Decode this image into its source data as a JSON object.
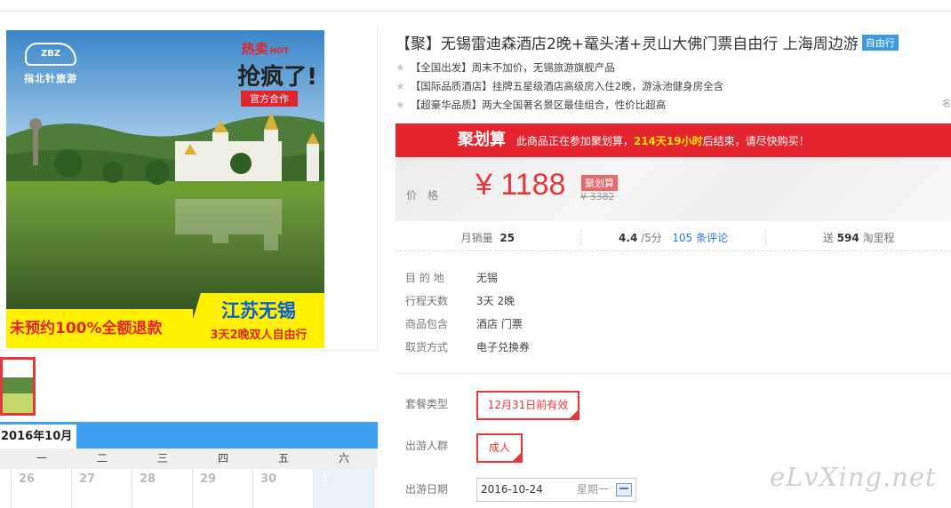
{
  "gallery": {
    "logo_badge": "ZBZ",
    "logo_text": "指北针旅游",
    "promo_hot": "热卖",
    "promo_hot_suffix": "HOT",
    "promo_big": "抢疯了!",
    "promo_tag": "官方合作",
    "banner_left": "未预约100%全额退款",
    "banner_right_title": "江苏无锡",
    "banner_right_sub": "3天2晚双人自由行"
  },
  "calendar": {
    "month": "2016年10月",
    "weekdays": [
      "",
      "一",
      "二",
      "三",
      "四",
      "五",
      "六"
    ],
    "days": [
      "",
      "26",
      "27",
      "28",
      "29",
      "30",
      "1"
    ]
  },
  "product": {
    "title": "【聚】无锡雷迪森酒店2晚+鼋头渚+灵山大佛门票自由行 上海周边游",
    "badge": "自由行",
    "features": [
      "【全国出发】周末不加价，无锡旅游旗舰产品",
      "【国际品质酒店】挂牌五星级酒店高级房入住2晚，游泳池健身房全含",
      "【超豪华品质】两大全国著名景区最佳组合，性价比超高"
    ],
    "feature_more": "名"
  },
  "juhuasuan": {
    "logo": "聚划算",
    "text_prefix": "此商品正在参加聚划算，",
    "countdown": "214天19小时",
    "text_suffix": "后结束，请尽快购买！"
  },
  "price": {
    "label": "价格",
    "value": "¥ 1188",
    "tag": "聚划算",
    "original": "¥ 3382"
  },
  "stats": {
    "monthly_sales_label": "月销量",
    "monthly_sales": "25",
    "rating": "4.4",
    "rating_suffix": " /5分",
    "reviews": "105 条评论",
    "points_prefix": "送 ",
    "points": "594",
    "points_suffix": " 淘里程"
  },
  "info": [
    {
      "key": "目 的 地",
      "value": "无锡"
    },
    {
      "key": "行程天数",
      "value": "3天  2晚"
    },
    {
      "key": "商品包含",
      "value": "酒店   门票"
    },
    {
      "key": "取货方式",
      "value": "电子兑换券"
    }
  ],
  "options": {
    "package_label": "套餐类型",
    "package_value": "12月31日前有效",
    "group_label": "出游人群",
    "group_value": "成人",
    "date_label": "出游日期",
    "date_value": "2016-10-24",
    "date_weekday": "星期一"
  },
  "watermark": "eLvXing.net",
  "colors": {
    "accent_red": "#e4393c",
    "calendar_blue": "#3f9ff0",
    "badge_blue": "#3b9be0",
    "countdown_yellow": "#ffe400"
  }
}
